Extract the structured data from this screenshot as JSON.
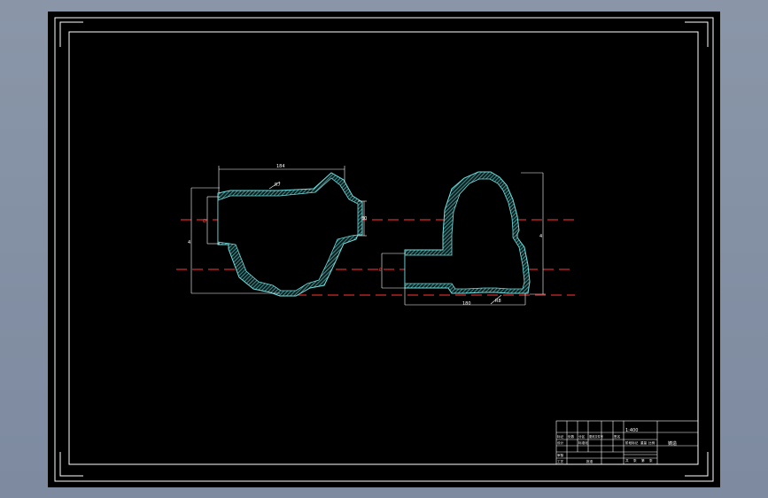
{
  "viewport": {
    "background": "#000000",
    "frame_color": "#ffffff",
    "outline_color": "#6ee0e0",
    "hatch_color": "#5fb7b7",
    "centerline_color": "#d42a2a",
    "dimension_color": "#ffffff"
  },
  "left_part": {
    "dim_top": "184",
    "dim_slope": "R7",
    "dim_right": "80",
    "dim_left_inner": "Ø",
    "dim_left_outer": "4"
  },
  "right_part": {
    "dim_height": "4",
    "dim_left": "Ø",
    "dim_bottom": "180",
    "dim_slope": "R8"
  },
  "title_block": {
    "scale": "1:400",
    "material": "铸造",
    "row1": [
      "标记",
      "处数",
      "分区",
      "更改文件号",
      "签名"
    ],
    "row2": [
      "设计",
      "标准化",
      "阶段标记",
      "重量",
      "比例"
    ],
    "row3": [
      "审核",
      "",
      "",
      ""
    ],
    "row4": [
      "工艺",
      "批准",
      "共",
      "张",
      "第",
      "张"
    ]
  }
}
